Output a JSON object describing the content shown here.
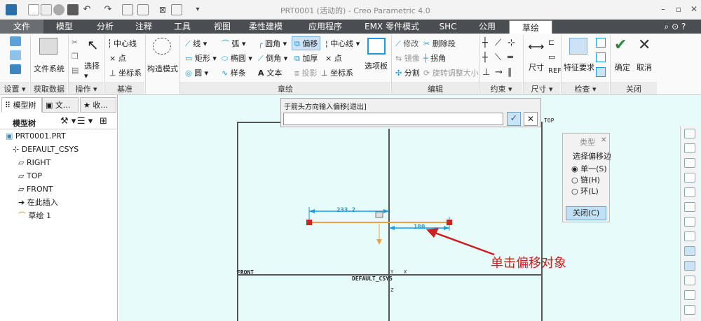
{
  "window": {
    "title": "PRT0001 (活动的) - Creo Parametric 4.0",
    "controls": {
      "minimize": "–",
      "maximize": "▫",
      "close": "✕"
    }
  },
  "menu_tabs": [
    "文件",
    "模型",
    "分析",
    "注释",
    "工具",
    "视图",
    "柔性建模",
    "应用程序",
    "EMX 零件模式",
    "SHC",
    "公用",
    "草绘"
  ],
  "active_tab": "草绘",
  "ribbon": {
    "setup": {
      "group": "设置"
    },
    "get_data": {
      "file_system": "文件系统",
      "group": "获取数据"
    },
    "operations": {
      "select": "选择",
      "group": "操作"
    },
    "datum": {
      "centerline": "中心线",
      "point": "点",
      "csys": "坐标系",
      "group": "基准"
    },
    "construction": {
      "label": "构造模式"
    },
    "sketching": {
      "line": "线",
      "rectangle": "矩形",
      "circle": "圆",
      "arc": "弧",
      "ellipse": "椭圆",
      "spline": "样条",
      "fillet": "圆角",
      "chamfer": "倒角",
      "text": "文本",
      "offset": "偏移",
      "thicken": "加厚",
      "project": "投影",
      "centerline": "中心线",
      "point": "点",
      "csys": "坐标系",
      "palette": "选项板",
      "group": "章绘"
    },
    "editing": {
      "modify": "修改",
      "delete_segment": "删除段",
      "mirror": "镜像",
      "corner": "拐角",
      "divide": "分割",
      "rotate_resize": "旋转调整大小",
      "group": "编辑"
    },
    "constrain": {
      "group": "约束"
    },
    "dimension": {
      "label": "尺寸",
      "group": "尺寸"
    },
    "inspect": {
      "feature_requirements": "特征要求",
      "group": "检查"
    },
    "close": {
      "ok": "确定",
      "cancel": "取消",
      "group": "关闭"
    }
  },
  "left_panel": {
    "tabs": [
      "模型树",
      "文...",
      "收..."
    ],
    "toolbar_label": "模型树",
    "tree": [
      "PRT0001.PRT",
      "DEFAULT_CSYS",
      "RIGHT",
      "TOP",
      "FRONT",
      "在此插入",
      "草绘 1"
    ]
  },
  "prompt": {
    "label": "于箭头方向输入偏移[退出]",
    "value": "",
    "ok": "✓",
    "cancel": "✕"
  },
  "canvas": {
    "plane_top": "TOP",
    "plane_front": "FRONT",
    "csys": "DEFAULT_CSYS",
    "axis_y": "Y",
    "axis_x": "X",
    "axis_z": "Z",
    "dim_1": "233.2",
    "dim_2": "180.",
    "annotation": "单击偏移对象",
    "colors": {
      "canvas_bg": "#e8fbfb",
      "sketch": "#f0a040",
      "dim": "#1a9be0",
      "handle": "#d62020",
      "arrow": "#cc2020"
    }
  },
  "type_panel": {
    "title": "类型",
    "close_glyph": "✕",
    "section": "选择偏移边",
    "options": [
      "单一(S)",
      "链(H)",
      "环(L)"
    ],
    "selected": 0,
    "close_button": "关闭(C)"
  }
}
